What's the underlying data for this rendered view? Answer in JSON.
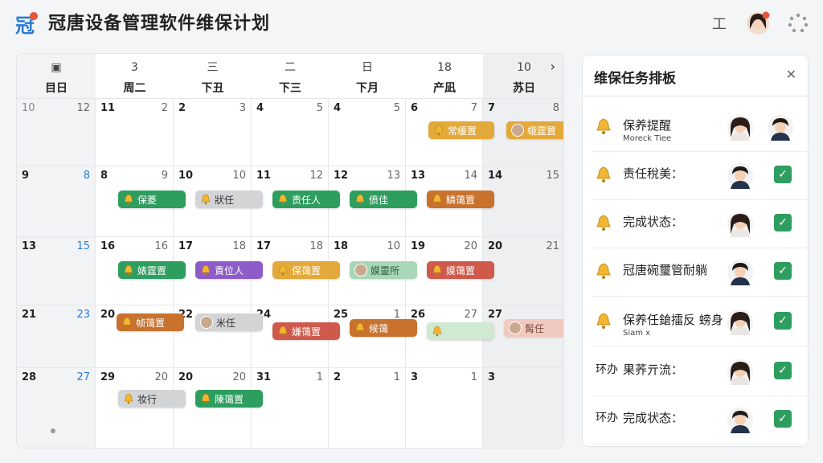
{
  "app": {
    "title": "冠唐设备管理软件维保计划"
  },
  "header": {
    "menu_icon": "工"
  },
  "calendar": {
    "headers": [
      {
        "top": "",
        "bottom": "目日"
      },
      {
        "top": "3",
        "bottom": "周二"
      },
      {
        "top": "三",
        "bottom": "下丑"
      },
      {
        "top": "二",
        "bottom": "下三"
      },
      {
        "top": "日",
        "bottom": "下月"
      },
      {
        "top": "18",
        "bottom": "产凪"
      },
      {
        "top": "10",
        "bottom": "苏日"
      }
    ],
    "rows": [
      {
        "first": "10",
        "first_r": "12",
        "days": [
          [
            "11",
            "2"
          ],
          [
            "2",
            "3"
          ],
          [
            "4",
            "5"
          ],
          [
            "4",
            "5"
          ],
          [
            "6",
            "7"
          ],
          [
            "7",
            "8"
          ]
        ]
      },
      {
        "first": "9",
        "first_r": "8",
        "days": [
          [
            "8",
            "9"
          ],
          [
            "10",
            "10"
          ],
          [
            "11",
            "12"
          ],
          [
            "12",
            "13"
          ],
          [
            "13",
            "14"
          ],
          [
            "14",
            "15"
          ]
        ]
      },
      {
        "first": "13",
        "first_r": "15",
        "days": [
          [
            "16",
            "16"
          ],
          [
            "17",
            "18"
          ],
          [
            "17",
            "18"
          ],
          [
            "18",
            "10"
          ],
          [
            "19",
            "20"
          ],
          [
            "20",
            "21"
          ]
        ]
      },
      {
        "first": "21",
        "first_r": "23",
        "days": [
          [
            "20",
            ""
          ],
          [
            "22",
            ""
          ],
          [
            "24",
            ""
          ],
          [
            "25",
            "1"
          ],
          [
            "26",
            "27"
          ],
          [
            "27",
            ""
          ]
        ]
      },
      {
        "first": "28",
        "first_r": "27",
        "days": [
          [
            "29",
            "20"
          ],
          [
            "20",
            "20"
          ],
          [
            "31",
            "1"
          ],
          [
            "2",
            "1"
          ],
          [
            "3",
            "1"
          ],
          [
            "3",
            ""
          ]
        ]
      }
    ],
    "events": [
      {
        "label": "常缓置",
        "style": "yellow",
        "icon": "bell"
      },
      {
        "label": "蛾霆置",
        "style": "yellow",
        "icon": "avatar"
      },
      {
        "label": "保菱",
        "style": "green",
        "icon": "bell"
      },
      {
        "label": "狀任",
        "style": "grey",
        "icon": "bell"
      },
      {
        "label": "责任人",
        "style": "green",
        "icon": "bell"
      },
      {
        "label": "偾佳",
        "style": "green",
        "icon": "bell"
      },
      {
        "label": "鳞蔼置",
        "style": "orange",
        "icon": "bell"
      },
      {
        "label": "婊霆置",
        "style": "green",
        "icon": "bell"
      },
      {
        "label": "責位人",
        "style": "purple",
        "icon": "bell"
      },
      {
        "label": "保蔼置",
        "style": "yellow",
        "icon": "bell"
      },
      {
        "label": "嫫靈所",
        "style": "lightgreen",
        "icon": "avatar"
      },
      {
        "label": "嫫蔼置",
        "style": "red",
        "icon": "bell"
      },
      {
        "label": "帧蔼置",
        "style": "orange",
        "icon": "bell"
      },
      {
        "label": "米任",
        "style": "grey",
        "icon": "avatar"
      },
      {
        "label": "嫌蔼置",
        "style": "red",
        "icon": "bell"
      },
      {
        "label": "候蔼",
        "style": "orange",
        "icon": "bell"
      },
      {
        "label": "",
        "style": "faint",
        "icon": "bell"
      },
      {
        "label": "髯任",
        "style": "pink",
        "icon": "avatar"
      },
      {
        "label": "妆行",
        "style": "grey",
        "icon": "bell"
      },
      {
        "label": "陳蔼置",
        "style": "green",
        "icon": "bell"
      }
    ]
  },
  "board": {
    "title": "维保任务排板",
    "tasks": [
      {
        "label": "保养提醒",
        "sub": "Moreck Tiee",
        "prefix": "",
        "check": false,
        "avatars": [
          "female",
          "male"
        ]
      },
      {
        "label": "责任稅美：",
        "sub": "",
        "prefix": "",
        "check": true,
        "avatars": [
          "male"
        ]
      },
      {
        "label": "完成状态：",
        "sub": "",
        "prefix": "",
        "check": true,
        "avatars": [
          "female"
        ]
      },
      {
        "label": "冠唐碗璽管耐躺",
        "sub": "",
        "prefix": "",
        "check": true,
        "avatars": [
          "male"
        ]
      },
      {
        "label": "保养任鎗擂反 螃身",
        "sub": "Siam x",
        "prefix": "",
        "check": true,
        "avatars": [
          "female"
        ]
      },
      {
        "label": "果荞亓流：",
        "sub": "",
        "prefix": "环办",
        "check": true,
        "avatars": [
          "female"
        ]
      },
      {
        "label": "完成状态：",
        "sub": "",
        "prefix": "环办",
        "check": true,
        "avatars": [
          "male"
        ]
      }
    ]
  },
  "colors": {
    "green": "#2e9e5f",
    "orange": "#c8722e",
    "yellow": "#e3a93a",
    "purple": "#8d5cc8",
    "red": "#cf5a4c",
    "blue": "#2a7bd4"
  }
}
